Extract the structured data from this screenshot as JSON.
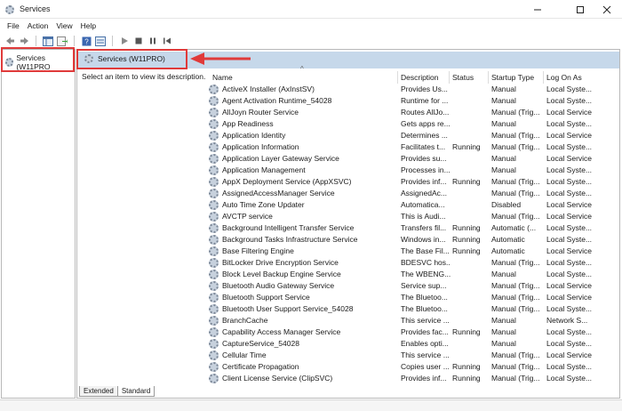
{
  "window": {
    "title": "Services",
    "icon": "services-gear-icon",
    "controls": [
      "minimize-icon",
      "maximize-icon",
      "close-icon"
    ]
  },
  "menu": [
    "File",
    "Action",
    "View",
    "Help"
  ],
  "toolbar": [
    "back-icon",
    "forward-icon",
    "console-tree-icon",
    "export-list-icon",
    "help-icon",
    "properties-icon",
    "play-icon",
    "stop-icon",
    "pause-icon",
    "restart-icon"
  ],
  "tree": {
    "root_label": "Services (W11PRO"
  },
  "pane": {
    "header_label": "Services (W11PRO)",
    "hint": "Select an item to view its description."
  },
  "columns": [
    "Name",
    "Description",
    "Status",
    "Startup Type",
    "Log On As"
  ],
  "services": [
    {
      "name": "ActiveX Installer (AxInstSV)",
      "description": "Provides Us...",
      "status": "",
      "startup": "Manual",
      "logon": "Local Syste..."
    },
    {
      "name": "Agent Activation Runtime_54028",
      "description": "Runtime for ...",
      "status": "",
      "startup": "Manual",
      "logon": "Local Syste..."
    },
    {
      "name": "AllJoyn Router Service",
      "description": "Routes AllJo...",
      "status": "",
      "startup": "Manual (Trig...",
      "logon": "Local Service"
    },
    {
      "name": "App Readiness",
      "description": "Gets apps re...",
      "status": "",
      "startup": "Manual",
      "logon": "Local Syste..."
    },
    {
      "name": "Application Identity",
      "description": "Determines ...",
      "status": "",
      "startup": "Manual (Trig...",
      "logon": "Local Service"
    },
    {
      "name": "Application Information",
      "description": "Facilitates t...",
      "status": "Running",
      "startup": "Manual (Trig...",
      "logon": "Local Syste..."
    },
    {
      "name": "Application Layer Gateway Service",
      "description": "Provides su...",
      "status": "",
      "startup": "Manual",
      "logon": "Local Service"
    },
    {
      "name": "Application Management",
      "description": "Processes in...",
      "status": "",
      "startup": "Manual",
      "logon": "Local Syste..."
    },
    {
      "name": "AppX Deployment Service (AppXSVC)",
      "description": "Provides inf...",
      "status": "Running",
      "startup": "Manual (Trig...",
      "logon": "Local Syste..."
    },
    {
      "name": "AssignedAccessManager Service",
      "description": "AssignedAc...",
      "status": "",
      "startup": "Manual (Trig...",
      "logon": "Local Syste..."
    },
    {
      "name": "Auto Time Zone Updater",
      "description": "Automatica...",
      "status": "",
      "startup": "Disabled",
      "logon": "Local Service"
    },
    {
      "name": "AVCTP service",
      "description": "This is Audi...",
      "status": "",
      "startup": "Manual (Trig...",
      "logon": "Local Service"
    },
    {
      "name": "Background Intelligent Transfer Service",
      "description": "Transfers fil...",
      "status": "Running",
      "startup": "Automatic (...",
      "logon": "Local Syste..."
    },
    {
      "name": "Background Tasks Infrastructure Service",
      "description": "Windows in...",
      "status": "Running",
      "startup": "Automatic",
      "logon": "Local Syste..."
    },
    {
      "name": "Base Filtering Engine",
      "description": "The Base Fil...",
      "status": "Running",
      "startup": "Automatic",
      "logon": "Local Service"
    },
    {
      "name": "BitLocker Drive Encryption Service",
      "description": "BDESVC hos...",
      "status": "",
      "startup": "Manual (Trig...",
      "logon": "Local Syste..."
    },
    {
      "name": "Block Level Backup Engine Service",
      "description": "The WBENG...",
      "status": "",
      "startup": "Manual",
      "logon": "Local Syste..."
    },
    {
      "name": "Bluetooth Audio Gateway Service",
      "description": "Service sup...",
      "status": "",
      "startup": "Manual (Trig...",
      "logon": "Local Service"
    },
    {
      "name": "Bluetooth Support Service",
      "description": "The Bluetoo...",
      "status": "",
      "startup": "Manual (Trig...",
      "logon": "Local Service"
    },
    {
      "name": "Bluetooth User Support Service_54028",
      "description": "The Bluetoo...",
      "status": "",
      "startup": "Manual (Trig...",
      "logon": "Local Syste..."
    },
    {
      "name": "BranchCache",
      "description": "This service ...",
      "status": "",
      "startup": "Manual",
      "logon": "Network S..."
    },
    {
      "name": "Capability Access Manager Service",
      "description": "Provides fac...",
      "status": "Running",
      "startup": "Manual",
      "logon": "Local Syste..."
    },
    {
      "name": "CaptureService_54028",
      "description": "Enables opti...",
      "status": "",
      "startup": "Manual",
      "logon": "Local Syste..."
    },
    {
      "name": "Cellular Time",
      "description": "This service ...",
      "status": "",
      "startup": "Manual (Trig...",
      "logon": "Local Service"
    },
    {
      "name": "Certificate Propagation",
      "description": "Copies user ...",
      "status": "Running",
      "startup": "Manual (Trig...",
      "logon": "Local Syste..."
    },
    {
      "name": "Client License Service (ClipSVC)",
      "description": "Provides inf...",
      "status": "Running",
      "startup": "Manual (Trig...",
      "logon": "Local Syste..."
    }
  ],
  "tabs": [
    "Extended",
    "Standard"
  ],
  "annotation_color": "#e03a3a",
  "header_color": "#c6d8ea"
}
